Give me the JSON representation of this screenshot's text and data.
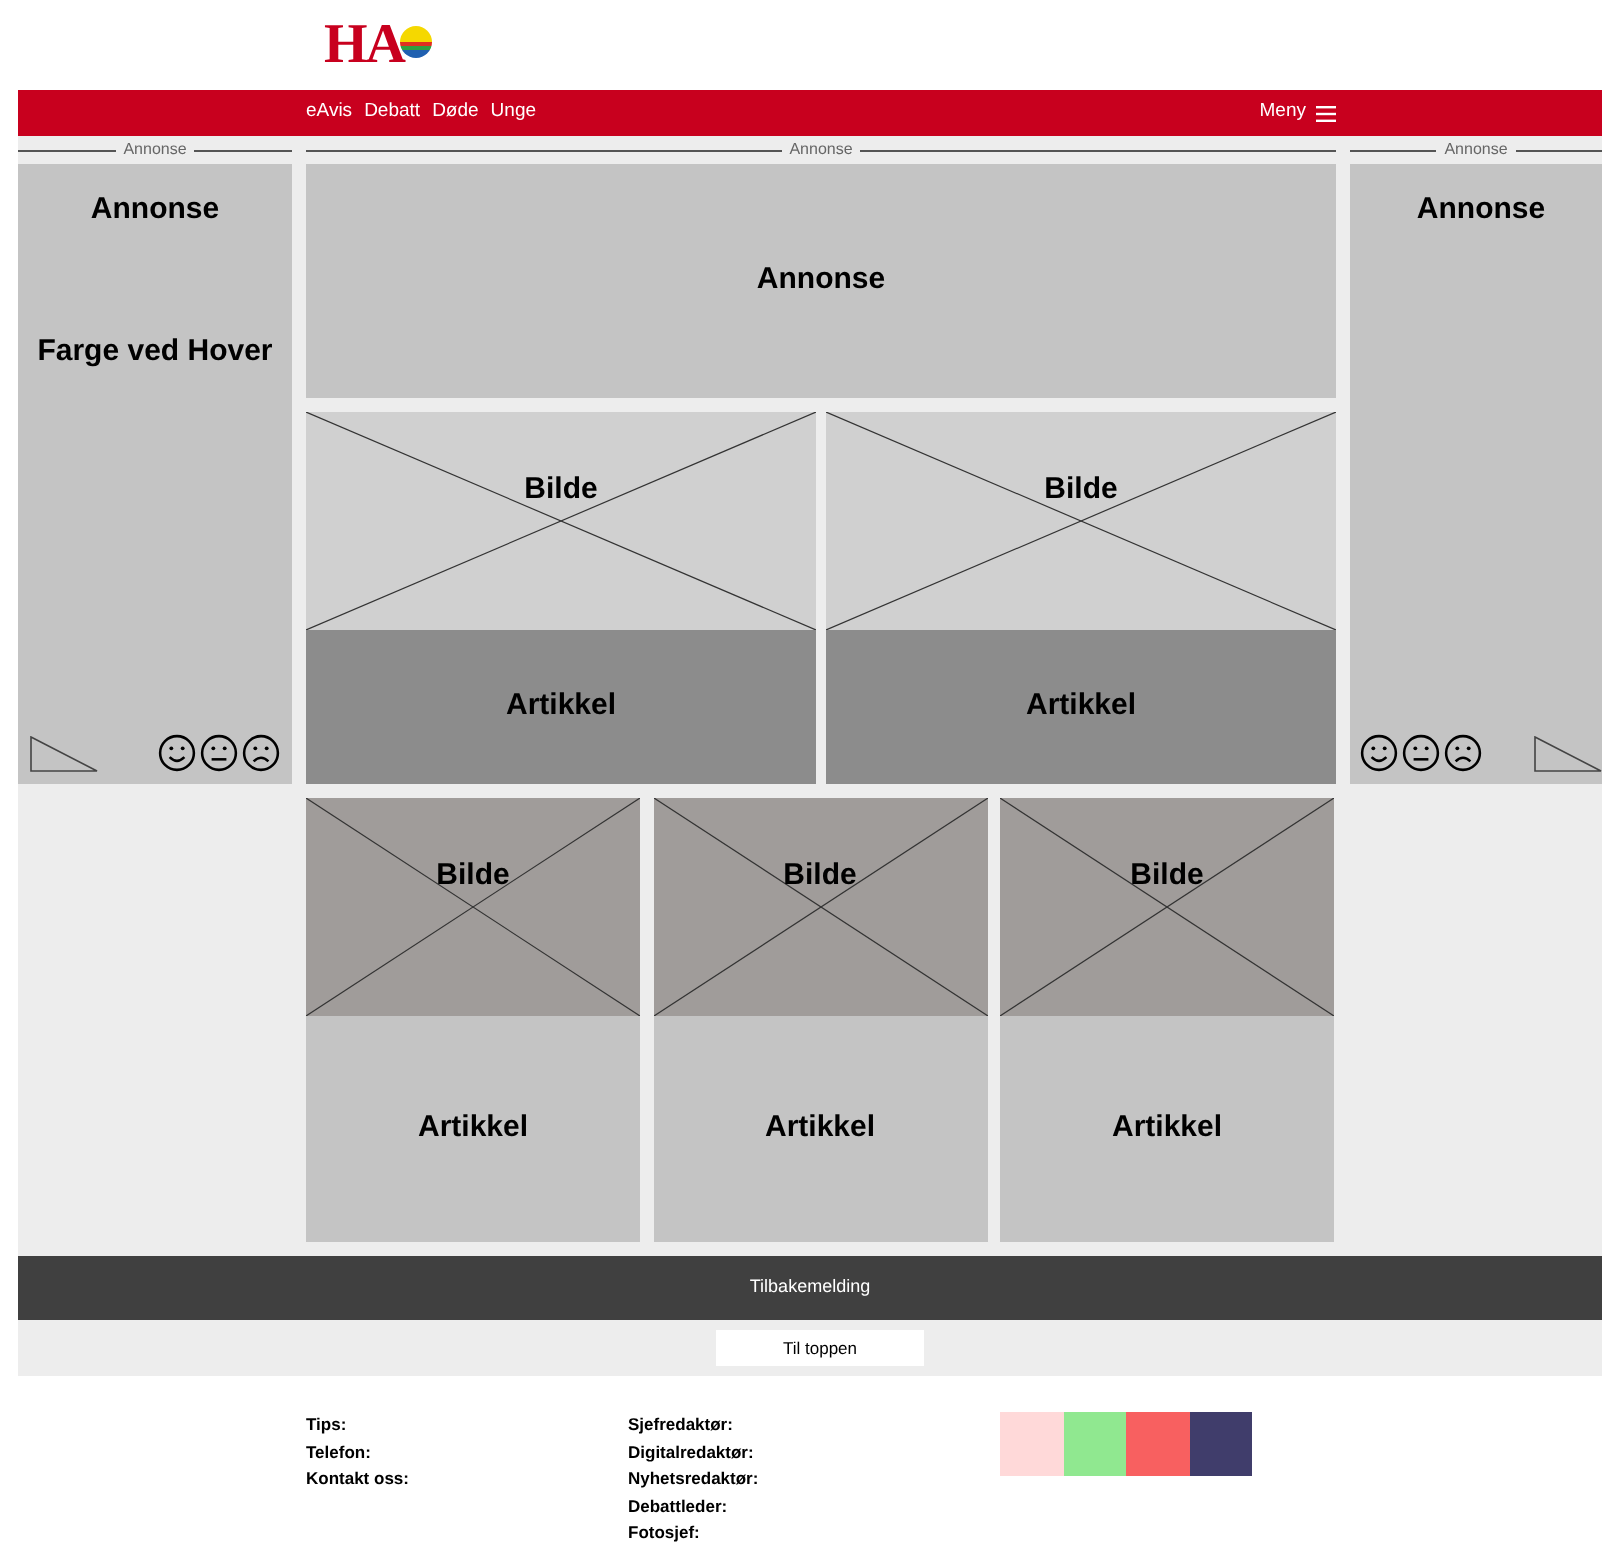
{
  "logo": {
    "text": "HA"
  },
  "nav": {
    "items": [
      "eAvis",
      "Debatt",
      "Døde",
      "Unge"
    ],
    "menu": "Meny"
  },
  "ad_labels": [
    "Annonse",
    "Annonse",
    "Annonse"
  ],
  "left_ad": {
    "title": "Annonse",
    "hover_text": "Farge ved Hover"
  },
  "top_ad": {
    "title": "Annonse"
  },
  "right_ad": {
    "title": "Annonse"
  },
  "feature_cards": [
    {
      "image": "Bilde",
      "article": "Artikkel"
    },
    {
      "image": "Bilde",
      "article": "Artikkel"
    }
  ],
  "cards": [
    {
      "image": "Bilde",
      "article": "Artikkel"
    },
    {
      "image": "Bilde",
      "article": "Artikkel"
    },
    {
      "image": "Bilde",
      "article": "Artikkel"
    }
  ],
  "feedback_bar": "Tilbakemelding",
  "to_top_button": "Til toppen",
  "footer": {
    "contacts": [
      "Tips:",
      "Telefon:",
      "Kontakt oss:"
    ],
    "editors": [
      "Sjefredaktør:",
      "Digitalredaktør:",
      "Nyhetsredaktør:",
      "Debattleder:",
      "Fotosjef:"
    ],
    "swatches": [
      {
        "color": "#ffd9d9"
      },
      {
        "color": "#90e890"
      },
      {
        "color": "#f86060"
      },
      {
        "color": "#403d6b"
      }
    ]
  }
}
